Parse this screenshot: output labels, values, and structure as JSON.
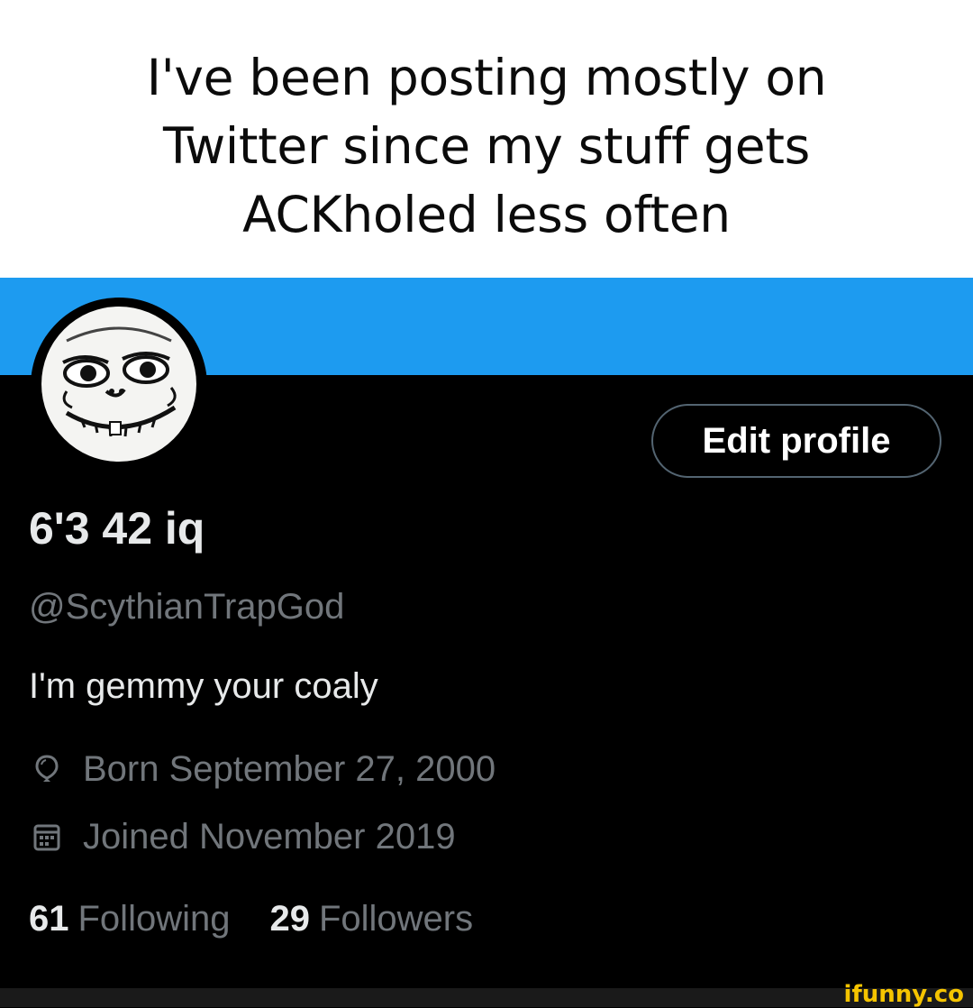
{
  "caption": {
    "lines": [
      "I've been posting mostly on",
      "Twitter since my stuff gets",
      "ACKholed less often"
    ]
  },
  "profile": {
    "edit_button_label": "Edit profile",
    "display_name": "6'3 42 iq",
    "handle": "@ScythianTrapGod",
    "bio": "I'm gemmy your coaly",
    "birthday": "Born September 27, 2000",
    "joined": "Joined November 2019",
    "following_count": "61",
    "following_label": "Following",
    "followers_count": "29",
    "followers_label": "Followers",
    "icons": {
      "birthday": "balloon-icon",
      "joined": "calendar-icon"
    }
  },
  "colors": {
    "banner": "#1d9bf0",
    "background": "#000000",
    "primary_text": "#e7e9ea",
    "secondary_text": "#71767b"
  },
  "watermark": "ifunny.co"
}
